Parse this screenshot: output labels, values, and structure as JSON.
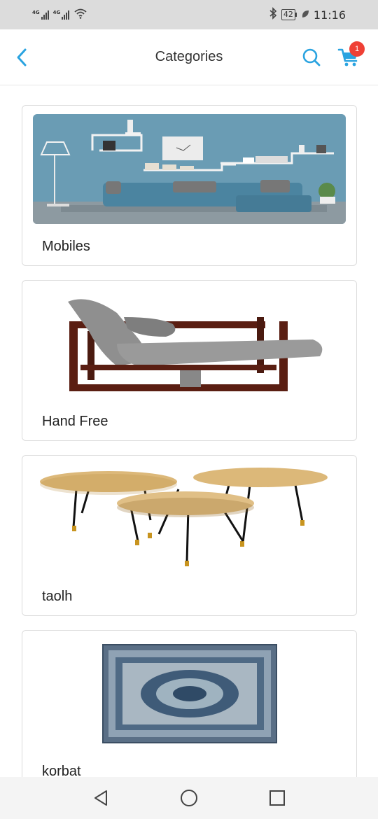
{
  "status_bar": {
    "net1": "4G",
    "net2": "4G",
    "battery": "42",
    "time": "11:16",
    "icons": [
      "signal-icon",
      "signal-icon",
      "wifi-icon",
      "bluetooth-icon",
      "battery-icon",
      "leaf-icon"
    ]
  },
  "app_bar": {
    "title": "Categories",
    "cart_count": "1",
    "icons": [
      "back-arrow-icon",
      "search-icon",
      "cart-icon"
    ],
    "accent_color": "#2aa3e0",
    "badge_color": "#ef4035"
  },
  "categories": [
    {
      "label": "Mobiles",
      "image": "living-room-sofa-photo"
    },
    {
      "label": "Hand Free",
      "image": "lounge-chair-photo"
    },
    {
      "label": "taolh",
      "image": "round-coffee-tables-photo"
    },
    {
      "label": "korbat",
      "image": "blue-rug-photo"
    }
  ],
  "nav_bar": {
    "icons": [
      "back-triangle-icon",
      "home-circle-icon",
      "recents-square-icon"
    ]
  }
}
